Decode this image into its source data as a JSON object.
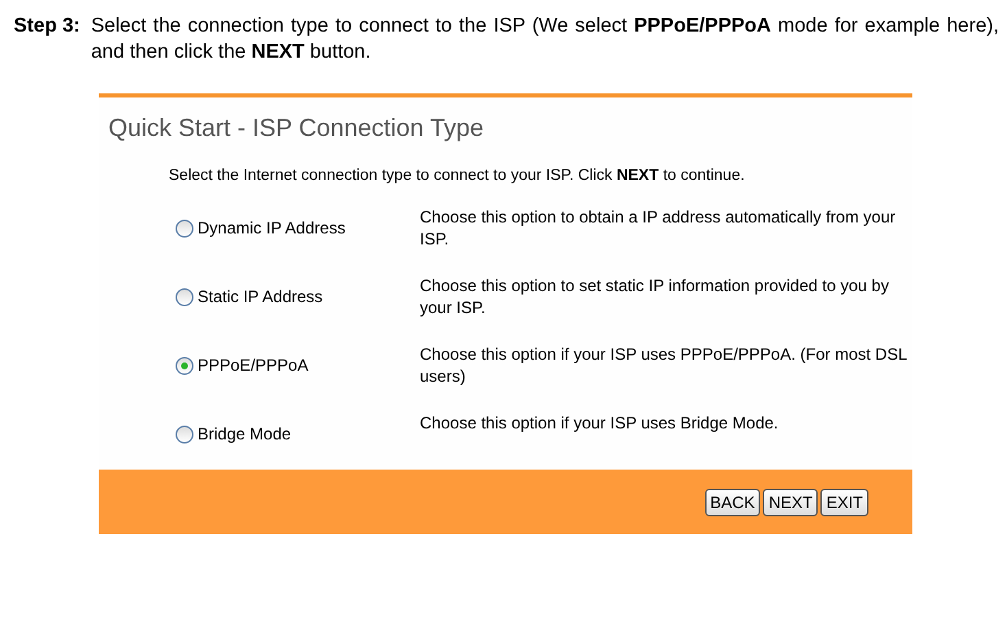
{
  "step": {
    "label": "Step 3:",
    "text": "Select the connection type to connect to the ISP (We select **PPPoE/PPPoA** mode for example here), and then click the **NEXT** button."
  },
  "panel": {
    "title": "Quick Start - ISP Connection Type",
    "intro": "Select the Internet connection type to connect to your ISP. Click **NEXT** to continue.",
    "options": [
      {
        "label": "Dynamic IP Address",
        "description": "Choose this option to obtain a IP address automatically from your ISP.",
        "selected": false
      },
      {
        "label": "Static IP Address",
        "description": "Choose this option to set static IP information provided to you by your ISP.",
        "selected": false
      },
      {
        "label": "PPPoE/PPPoA",
        "description": "Choose this option if your ISP uses PPPoE/PPPoA. (For most DSL users)",
        "selected": true
      },
      {
        "label": "Bridge Mode",
        "description": "Choose this option if your ISP uses Bridge Mode.",
        "selected": false
      }
    ],
    "buttons": [
      "BACK",
      "NEXT",
      "EXIT"
    ]
  }
}
